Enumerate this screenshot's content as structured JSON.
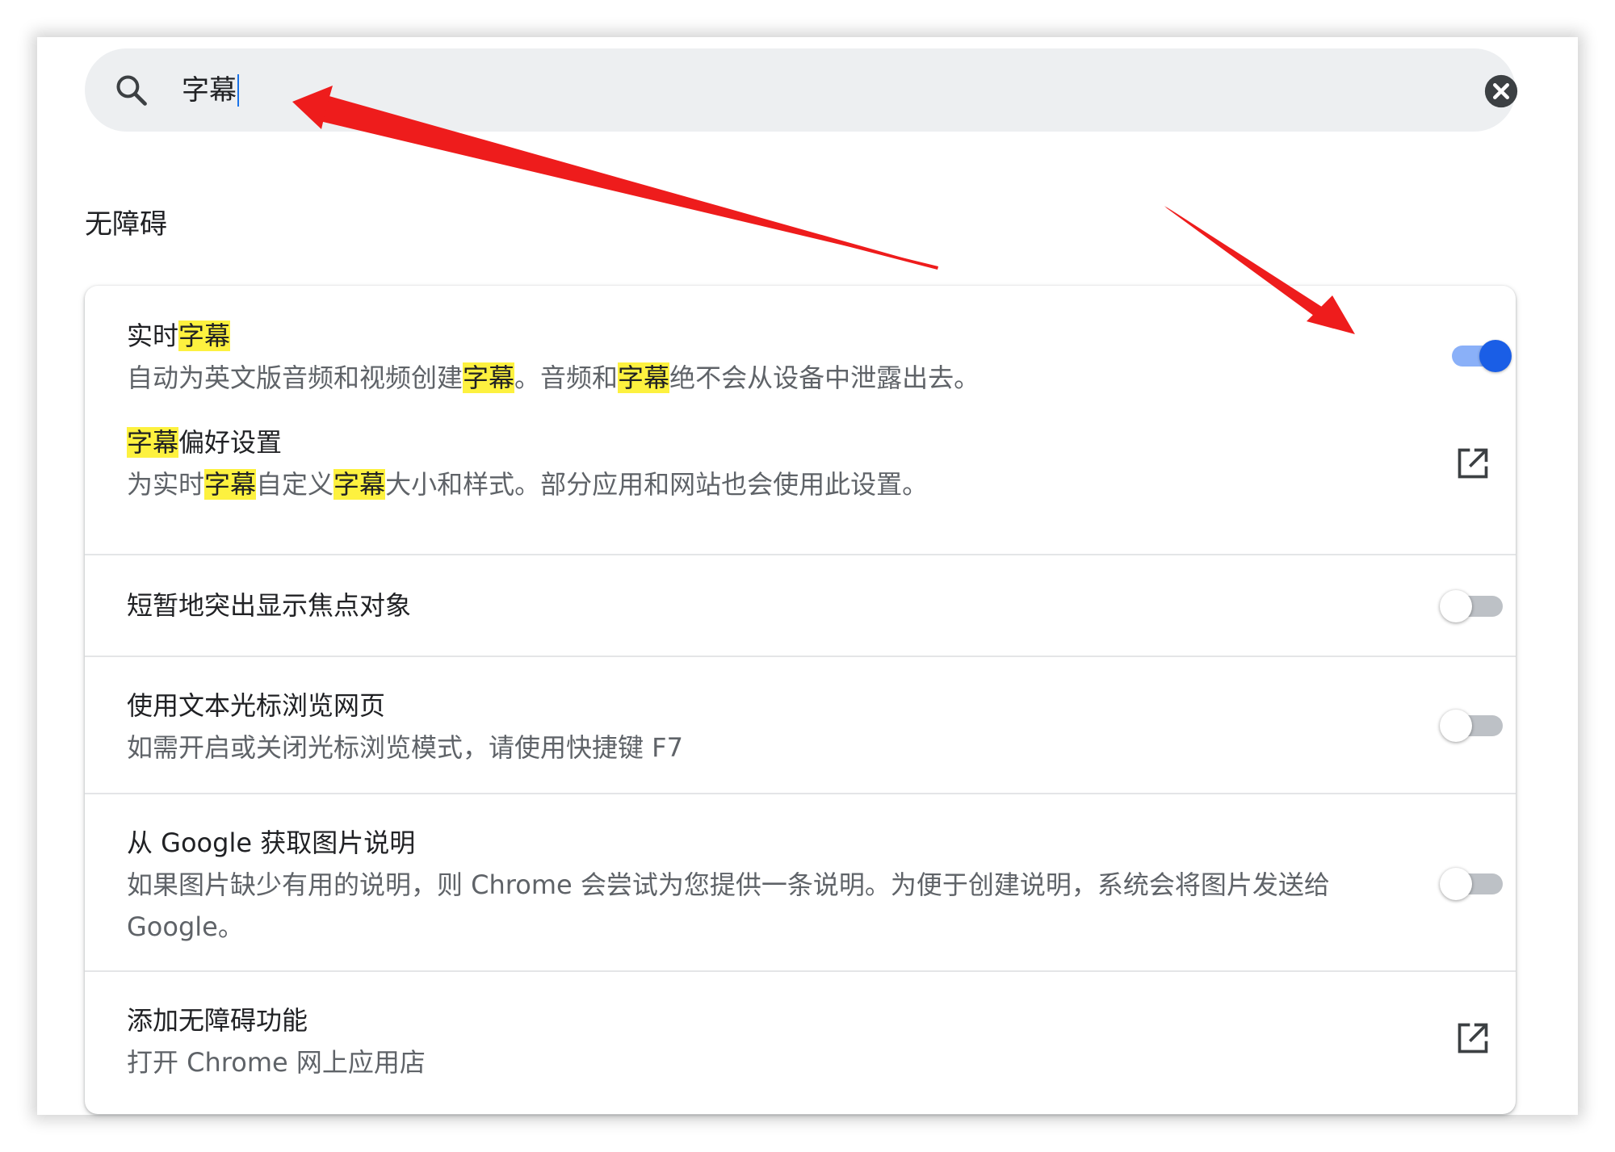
{
  "search": {
    "value": "字幕",
    "icon": "search-icon",
    "clear_icon": "clear-circle-icon"
  },
  "section": {
    "title": "无障碍"
  },
  "settings": [
    {
      "title_parts": [
        "实时",
        "字幕"
      ],
      "desc_parts": [
        "自动为英文版音频和视频创建",
        "字幕",
        "。音频和",
        "字幕",
        "绝不会从设备中泄露出去。"
      ],
      "control": "toggle",
      "enabled": true
    },
    {
      "title_parts": [
        "字幕",
        "偏好设置"
      ],
      "desc_parts": [
        "为实时",
        "字幕",
        "自定义",
        "字幕",
        "大小和样式。部分应用和网站也会使用此设置。"
      ],
      "control": "external-link-icon"
    },
    {
      "title": "短暂地突出显示焦点对象",
      "control": "toggle",
      "enabled": false
    },
    {
      "title": "使用文本光标浏览网页",
      "desc": "如需开启或关闭光标浏览模式，请使用快捷键 F7",
      "control": "toggle",
      "enabled": false
    },
    {
      "title": "从 Google 获取图片说明",
      "desc": "如果图片缺少有用的说明，则 Chrome 会尝试为您提供一条说明。为便于创建说明，系统会将图片发送给 Google。",
      "control": "toggle",
      "enabled": false
    },
    {
      "title": "添加无障碍功能",
      "desc": "打开 Chrome 网上应用店",
      "control": "external-link-icon"
    }
  ],
  "colors": {
    "highlight": "#fdf13f",
    "toggle_on": "#1a5ee6",
    "toggle_on_track": "#8ab0f8",
    "toggle_off_track": "#bdc1c6",
    "annotation_arrow": "#ee1c1c"
  }
}
